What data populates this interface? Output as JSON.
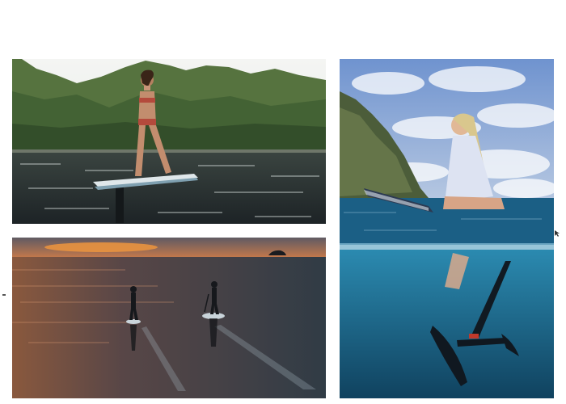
{
  "photos": [
    {
      "name": "hydrofoil-rider-standing-mountains"
    },
    {
      "name": "rider-sitting-on-board-split-underwater-view"
    },
    {
      "name": "two-riders-at-sunset"
    }
  ],
  "colors": {
    "background": "#ffffff",
    "sky_clear": "#f2f4f3",
    "mountain_green": "#4d6b3c",
    "water_dark": "#283036",
    "sky_blue": "#7f9fd1",
    "ocean_blue": "#1e6f94",
    "sunset_orange": "#e08a4a"
  }
}
